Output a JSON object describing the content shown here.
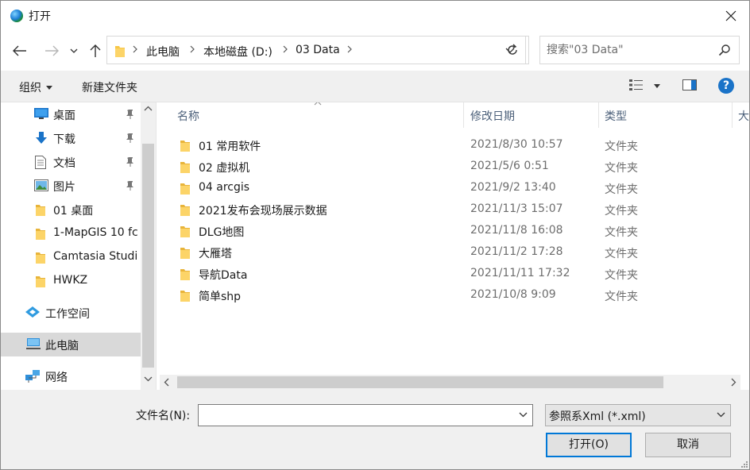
{
  "window": {
    "title": "打开",
    "close_glyph": "✕"
  },
  "nav": {
    "breadcrumbs": [
      "此电脑",
      "本地磁盘 (D:)",
      "03 Data"
    ],
    "search_placeholder": "搜索\"03 Data\""
  },
  "commandbar": {
    "organize": "组织",
    "new_folder": "新建文件夹"
  },
  "sidebar": {
    "items": [
      {
        "label": "桌面",
        "icon": "desktop-icon",
        "pinned": true
      },
      {
        "label": "下载",
        "icon": "download-icon",
        "pinned": true
      },
      {
        "label": "文档",
        "icon": "document-icon",
        "pinned": true
      },
      {
        "label": "图片",
        "icon": "pictures-icon",
        "pinned": true
      },
      {
        "label": "01 桌面",
        "icon": "folder-icon",
        "pinned": false
      },
      {
        "label": "1-MapGIS 10 fc",
        "icon": "folder-icon",
        "pinned": false
      },
      {
        "label": "Camtasia Studi",
        "icon": "folder-icon",
        "pinned": false
      },
      {
        "label": "HWKZ",
        "icon": "folder-icon",
        "pinned": false
      },
      {
        "label": "工作空间",
        "icon": "workspace-icon",
        "pinned": false
      },
      {
        "label": "此电脑",
        "icon": "computer-icon",
        "pinned": false,
        "selected": true
      },
      {
        "label": "网络",
        "icon": "network-icon",
        "pinned": false
      }
    ]
  },
  "filelist": {
    "columns": {
      "name": "名称",
      "date": "修改日期",
      "type": "类型",
      "size": "大"
    },
    "rows": [
      {
        "name": "01 常用软件",
        "date": "2021/8/30 10:57",
        "type": "文件夹"
      },
      {
        "name": "02 虚拟机",
        "date": "2021/5/6 0:51",
        "type": "文件夹"
      },
      {
        "name": "04 arcgis",
        "date": "2021/9/2 13:40",
        "type": "文件夹"
      },
      {
        "name": "2021发布会现场展示数据",
        "date": "2021/11/3 15:07",
        "type": "文件夹"
      },
      {
        "name": "DLG地图",
        "date": "2021/11/8 16:08",
        "type": "文件夹"
      },
      {
        "name": "大雁塔",
        "date": "2021/11/2 17:28",
        "type": "文件夹"
      },
      {
        "name": "导航Data",
        "date": "2021/11/11 17:32",
        "type": "文件夹"
      },
      {
        "name": "简单shp",
        "date": "2021/10/8 9:09",
        "type": "文件夹"
      }
    ]
  },
  "bottom": {
    "filename_label": "文件名(N):",
    "filename_value": "",
    "filter": "参照系Xml (*.xml)",
    "open": "打开(O)",
    "cancel": "取消"
  },
  "colors": {
    "accent": "#0078d7",
    "folder": "#f7c747",
    "help": "#1a73c8"
  }
}
